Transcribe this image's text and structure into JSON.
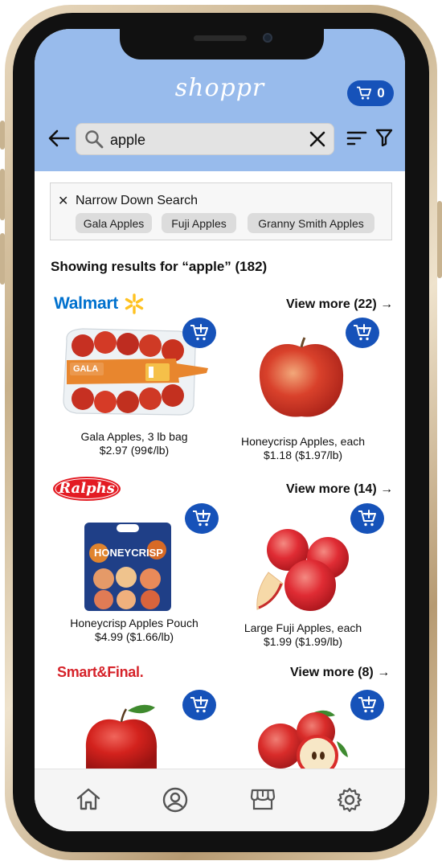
{
  "app": {
    "brand": "shoppr",
    "cart_count": "0"
  },
  "search": {
    "value": "apple"
  },
  "narrow": {
    "title": "Narrow Down Search",
    "chips": [
      "Gala Apples",
      "Fuji Apples",
      "Granny Smith Apples"
    ]
  },
  "results_label": "Showing results for “apple” (182)",
  "stores": [
    {
      "name": "Walmart",
      "view_more": "View more (22) →",
      "products": [
        {
          "name": "Gala Apples, 3 lb bag",
          "price": "$2.97 (99¢/lb)",
          "bag_text": "GALA"
        },
        {
          "name": "Honeycrisp Apples, each",
          "price": "$1.18 ($1.97/lb)"
        }
      ]
    },
    {
      "name": "Ralphs",
      "view_more": "View more (14) →",
      "products": [
        {
          "name": "Honeycrisp Apples Pouch",
          "price": "$4.99 ($1.66/lb)",
          "bag_text": "HONEYCRISP"
        },
        {
          "name": "Large Fuji Apples, each",
          "price": "$1.99 ($1.99/lb)"
        }
      ]
    },
    {
      "name": "Smart&Final.",
      "view_more": "View more (8) →",
      "products": [
        {},
        {}
      ]
    }
  ],
  "colors": {
    "header_bg": "#98bbec",
    "accent": "#1652b9",
    "walmart_blue": "#0071ce",
    "walmart_yellow": "#ffc220",
    "ralphs_red": "#e31b23",
    "smartfinal_red": "#d6232a"
  },
  "icons": {
    "back": "arrow-left-icon",
    "search": "search-icon",
    "clear": "close-icon",
    "sort": "sort-icon",
    "filter": "filter-icon",
    "cart": "cart-icon",
    "add_to_cart": "cart-plus-icon",
    "nav": [
      "home-icon",
      "account-icon",
      "store-icon",
      "settings-icon"
    ]
  }
}
